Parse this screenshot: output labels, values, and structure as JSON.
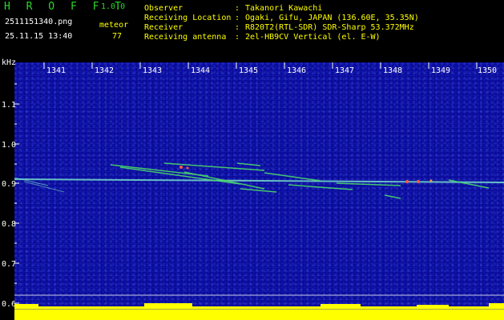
{
  "header": {
    "app_title": "H R O F F T",
    "version": "1.0.0",
    "filename": "2511151340.png",
    "datetime": "25.11.15 13:40",
    "mode_label": "meteor",
    "count": "77",
    "info_labels": [
      "Observer",
      "Receiving Location",
      "Receiver",
      "Receiving antenna"
    ],
    "info_separator": ":",
    "info_values": [
      "Takanori Kawachi",
      "Ogaki, Gifu, JAPAN (136.60E, 35.35N)",
      "R820T2(RTL-SDR) SDR-Sharp 53.372MHz",
      "2el-HB9CV Vertical (el. E-W)"
    ]
  },
  "axes": {
    "y_unit": "kHz",
    "y_ticks": [
      "1.1",
      "1.0",
      "0.9",
      "0.8",
      "0.7",
      "0.6"
    ],
    "x_ticks": [
      "1341",
      "1342",
      "1343",
      "1344",
      "1345",
      "1346",
      "1347",
      "1348",
      "1349",
      "1350"
    ]
  },
  "colors": {
    "background": "#000000",
    "spectrogram_base": "#0c0ea3",
    "header_green": "#2bd62b",
    "carrier_line": "#6fd0c8",
    "meteor_trace": "#49d96a",
    "noise_bar": "#ffff00"
  }
}
